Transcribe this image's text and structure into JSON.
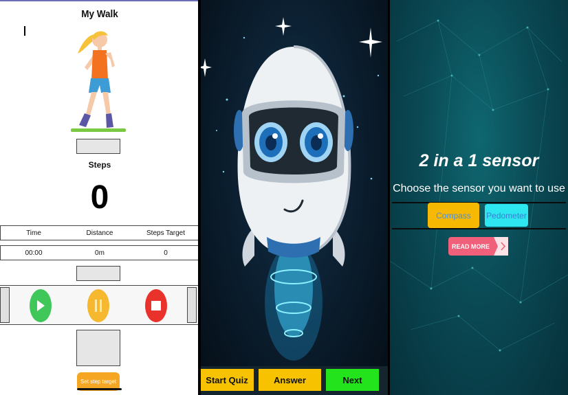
{
  "walk": {
    "title": "My Walk",
    "steps_label": "Steps",
    "steps_value": "0",
    "headers": [
      "Time",
      "Distance",
      "Steps Target"
    ],
    "values": [
      "00:00",
      "0m",
      "0"
    ],
    "set_target_label": "Set step target"
  },
  "quiz": {
    "start_label": "Start Quiz",
    "answer_label": "Answer",
    "next_label": "Next"
  },
  "sensor": {
    "title": "2 in a 1 sensor",
    "subtitle": "Choose the sensor you want to use",
    "compass_label": "Compass",
    "pedometer_label": "Pedometer",
    "read_more_label": "READ MORE"
  },
  "colors": {
    "play": "#3fc75a",
    "pause": "#f5b82e",
    "stop": "#e8322b",
    "start_quiz": "#f7c300",
    "answer": "#f7c300",
    "next": "#22e31c",
    "compass": "#f7b801",
    "pedometer": "#2ee6f0",
    "read_more": "#f0607a"
  },
  "icons": {
    "play": "play-icon",
    "pause": "pause-icon",
    "stop": "stop-icon",
    "read_more_arrow": "chevron-right-icon"
  }
}
